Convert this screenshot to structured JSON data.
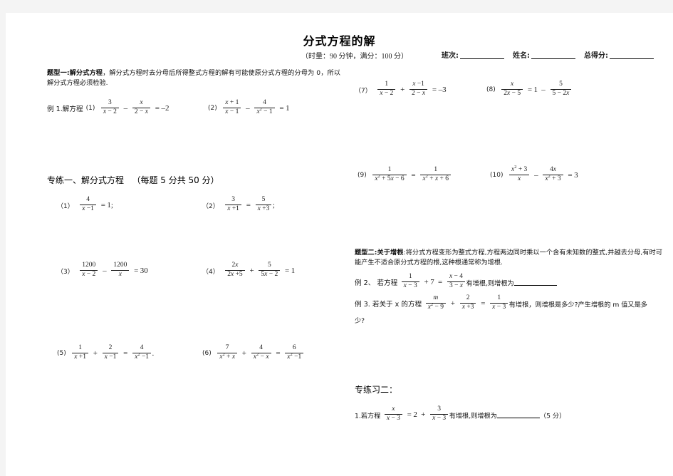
{
  "document": {
    "title": "分式方程的解",
    "exam_info": "（时量：90 分钟，满分：100 分）",
    "fields": [
      {
        "label": "班次:"
      },
      {
        "label": "姓名:"
      },
      {
        "label": "总得分:"
      }
    ]
  },
  "sections": {
    "type1": {
      "heading": "题型一:解分式方程",
      "body": "，解分式方程时去分母后所得整式方程的解有可能使原分式方程的分母为 0，所以解分式方程必须检验.",
      "example_label": "例 1.解方程"
    },
    "drill1": {
      "heading": "专练一、解分式方程",
      "points": "（每题 5 分共 50 分）"
    },
    "type2": {
      "heading": "题型二:关于增根",
      "body": ":将分式方程变形为整式方程,方程两边同时乘以一个含有未知数的整式,并越去分母,有时可能产生不适合原分式方程的根,这种根通常称为增根.",
      "example2_prefix": "例 2、  若方程",
      "example2_suffix": "有增根,则增根为",
      "example3_prefix": "例 3.  若关于 x 的方程",
      "example3_suffix": "有增根，则增根是多少?产生增根的 m 值又是多",
      "example3_tail": "少?"
    },
    "drill2": {
      "heading": "专练习二：",
      "item1_prefix": "1.若方程",
      "item1_suffix": "有增根,则增根为",
      "item1_points": "（5 分）"
    }
  },
  "problems": {
    "ex1": [
      {
        "num": "(1)",
        "latex": "3/(x-2) - x/(2-x) = -2"
      },
      {
        "num": "(2)",
        "latex": "(x+1)/(x-1) - 4/(x^2-1) = 1"
      }
    ],
    "drill1": [
      {
        "num": "（1）",
        "latex": "4/(x-1) = 1;"
      },
      {
        "num": "（2）",
        "latex": "3/(x+1) = 5/(x+3);"
      },
      {
        "num": "（3）",
        "latex": "1200/(x-2) - 1200/x = 30"
      },
      {
        "num": "（4）",
        "latex": "2x/(2x+5) + 5/(5x-2) = 1"
      },
      {
        "num": "(5)",
        "latex": "1/(x+1) + 2/(x-1) = 4/(x^2-1)."
      },
      {
        "num": "(6)",
        "latex": "7/(x^2+x) + 4/(x^2-x) = 6/(x^2-1)"
      },
      {
        "num": "（7）",
        "latex": "1/(x-2) + (x-1)/(2-x) = -3"
      },
      {
        "num": "(8)",
        "latex": "x/(2x-5) = 1 - 5/(5-2x)"
      },
      {
        "num": "(9)",
        "latex": "1/(x^2+5x-6) = 1/(x^2+x+6)"
      },
      {
        "num": "(10)",
        "latex": "(x^2+3)/x - 4x/(x^2+3) = 3"
      }
    ],
    "ex2": {
      "latex": "1/(x-3) + 7 = (x-4)/(3-x)"
    },
    "ex3": {
      "latex": "m/(x^2-9) + 2/(x+3) = 1/(x-3)"
    },
    "drill2_1": {
      "latex": "x/(x-3) = 2 + 3/(x-3)"
    }
  }
}
